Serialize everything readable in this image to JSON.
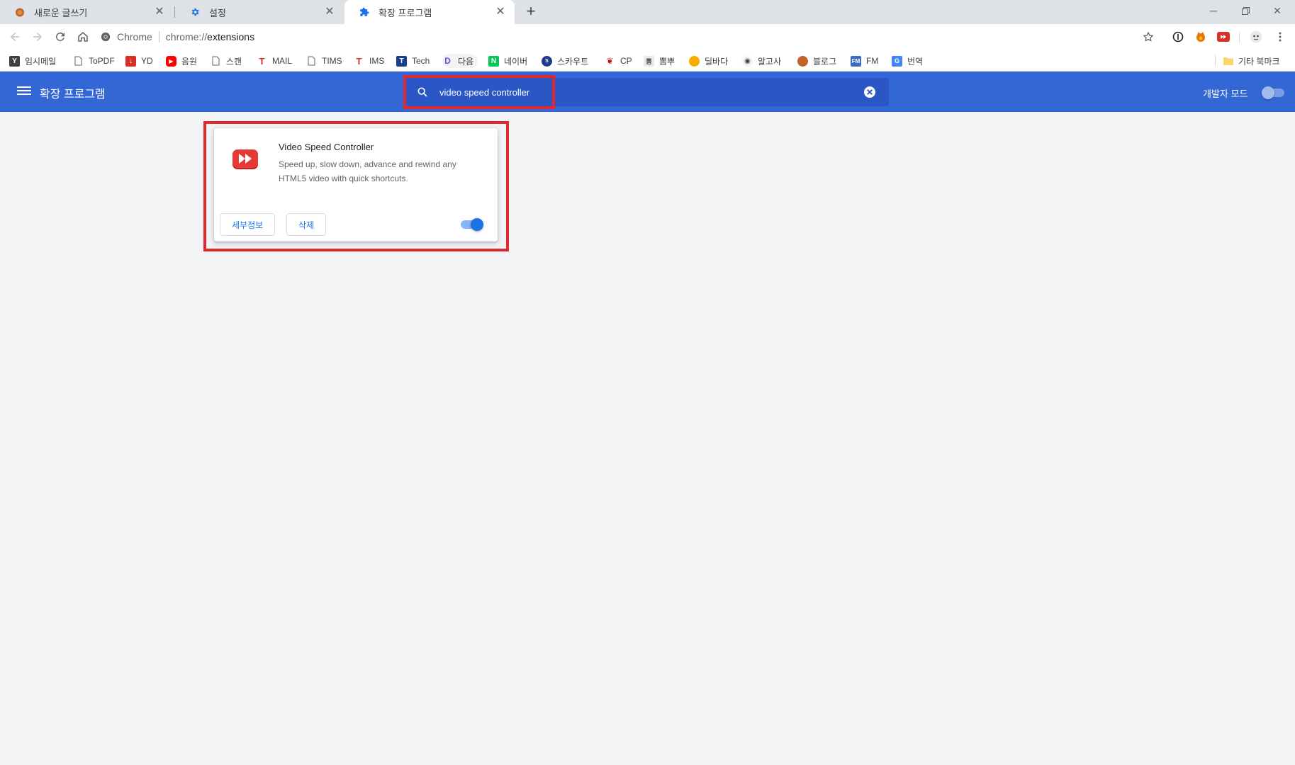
{
  "tabs": [
    {
      "title": "새로운 글쓰기",
      "icon": "blog-icon",
      "active": false
    },
    {
      "title": "설정",
      "icon": "gear-icon",
      "active": false
    },
    {
      "title": "확장 프로그램",
      "icon": "puzzle-icon",
      "active": true
    }
  ],
  "toolbar": {
    "omnibox_chip": "Chrome",
    "url_scheme": "chrome://",
    "url_path": "extensions"
  },
  "bookmarks": [
    {
      "label": "임시메일",
      "icon": "y-icon"
    },
    {
      "label": "ToPDF",
      "icon": "page-icon"
    },
    {
      "label": "YD",
      "icon": "download-icon"
    },
    {
      "label": "음원",
      "icon": "youtube-icon"
    },
    {
      "label": "스캔",
      "icon": "page-icon"
    },
    {
      "label": "MAIL",
      "icon": "t-icon"
    },
    {
      "label": "TIMS",
      "icon": "page-icon"
    },
    {
      "label": "IMS",
      "icon": "t-icon"
    },
    {
      "label": "Tech",
      "icon": "tech-icon"
    },
    {
      "label": "다음",
      "icon": "daum-icon"
    },
    {
      "label": "네이버",
      "icon": "naver-icon"
    },
    {
      "label": "스카우트",
      "icon": "scout-icon"
    },
    {
      "label": "CP",
      "icon": "cherry-icon"
    },
    {
      "label": "뽐뿌",
      "icon": "ppomppu-icon"
    },
    {
      "label": "딜바다",
      "icon": "dealbada-icon"
    },
    {
      "label": "알고사",
      "icon": "algosa-icon"
    },
    {
      "label": "블로그",
      "icon": "blog-icon"
    },
    {
      "label": "FM",
      "icon": "fm-icon"
    },
    {
      "label": "번역",
      "icon": "translate-icon"
    }
  ],
  "other_bookmarks": "기타 북마크",
  "extensions_page": {
    "title": "확장 프로그램",
    "search_value": "video speed controller",
    "dev_mode_label": "개발자 모드",
    "dev_mode_enabled": false
  },
  "extension": {
    "name": "Video Speed Controller",
    "description": "Speed up, slow down, advance and rewind any HTML5 video with quick shortcuts.",
    "details_label": "세부정보",
    "remove_label": "삭제",
    "enabled": true
  },
  "colors": {
    "header": "#3367d6",
    "search_bg": "#2a56c6",
    "highlight": "#e0282e",
    "accent": "#1a73e8"
  }
}
